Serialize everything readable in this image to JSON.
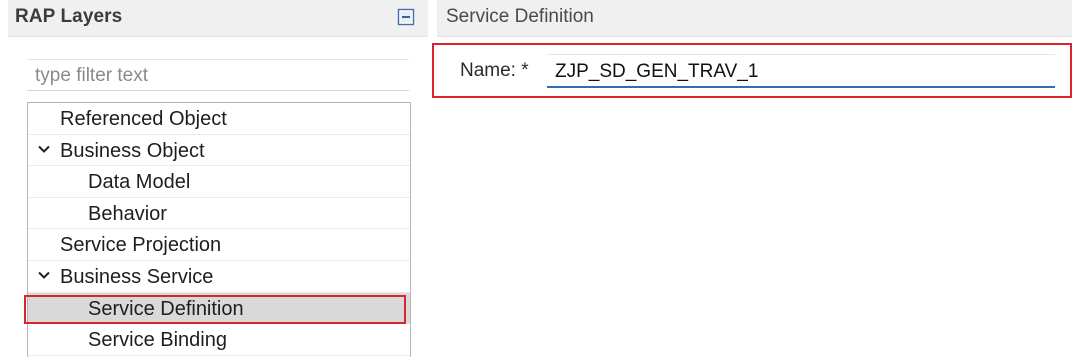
{
  "left_panel": {
    "title": "RAP Layers",
    "collapse_icon": "collapse-all-icon",
    "filter": {
      "placeholder": "type filter text",
      "value": ""
    },
    "tree": [
      {
        "label": "Referenced Object",
        "indent": 1,
        "expandable": false,
        "selected": false
      },
      {
        "label": "Business Object",
        "indent": 1,
        "expandable": true,
        "expanded": true,
        "selected": false
      },
      {
        "label": "Data Model",
        "indent": 2,
        "expandable": false,
        "selected": false
      },
      {
        "label": "Behavior",
        "indent": 2,
        "expandable": false,
        "selected": false
      },
      {
        "label": "Service Projection",
        "indent": 1,
        "expandable": false,
        "selected": false
      },
      {
        "label": "Business Service",
        "indent": 1,
        "expandable": true,
        "expanded": true,
        "selected": false
      },
      {
        "label": "Service Definition",
        "indent": 2,
        "expandable": false,
        "selected": true
      },
      {
        "label": "Service Binding",
        "indent": 2,
        "expandable": false,
        "selected": false
      }
    ]
  },
  "right_panel": {
    "title": "Service Definition",
    "name_field": {
      "label": "Name: *",
      "value": "ZJP_SD_GEN_TRAV_1"
    }
  },
  "colors": {
    "highlight_red": "#d9262e",
    "focus_blue": "#2f6fb0",
    "header_bg": "#f0f0f0",
    "selected_bg": "#d9d9d9"
  }
}
